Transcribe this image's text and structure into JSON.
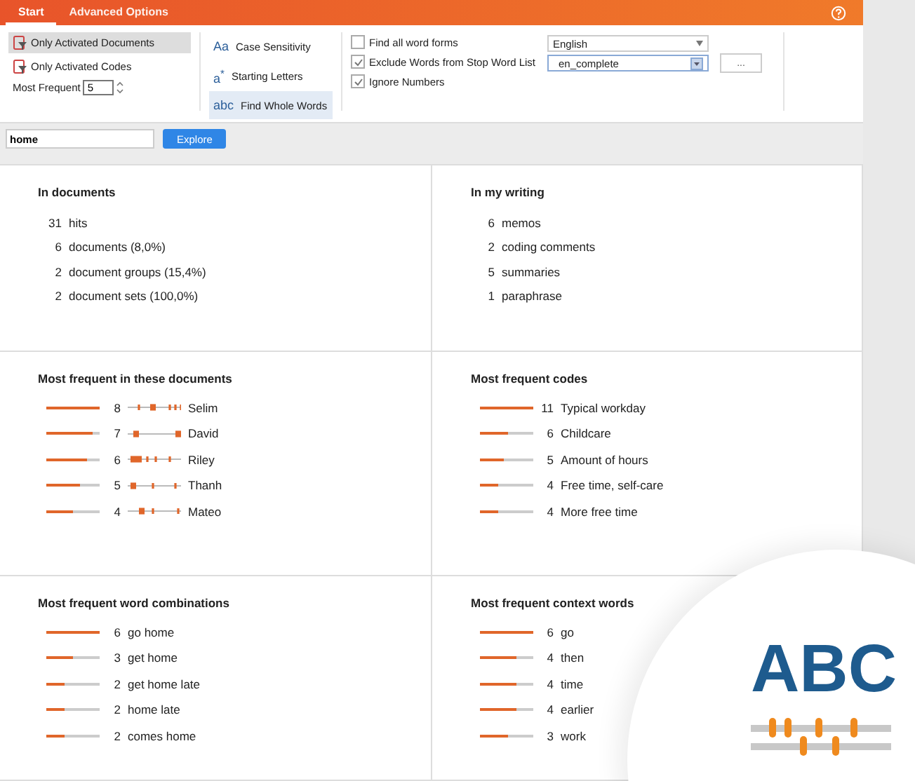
{
  "tabs": [
    {
      "label": "Start",
      "selected": true
    },
    {
      "label": "Advanced Options",
      "selected": false
    }
  ],
  "ribbon": {
    "filters": [
      {
        "label": "Only Activated Documents",
        "selected": true
      },
      {
        "label": "Only Activated Codes",
        "selected": false
      }
    ],
    "most_frequent": {
      "label": "Most Frequent",
      "value": "5"
    },
    "match_options": [
      {
        "icon": "Aa",
        "label": "Case Sensitivity",
        "selected": false
      },
      {
        "icon": "a$^{*}$",
        "label": "Starting Letters",
        "selected": false
      },
      {
        "icon": "abc",
        "label": "Find Whole Words",
        "selected": true
      }
    ],
    "checkboxes": [
      {
        "label": "Find all word forms",
        "checked": false
      },
      {
        "label": "Exclude Words from Stop Word List",
        "checked": true
      },
      {
        "label": "Ignore Numbers",
        "checked": true
      }
    ],
    "language": "English",
    "stop_word_list": "en_complete",
    "more_button": "..."
  },
  "search": {
    "value": "home",
    "button": "Explore"
  },
  "panels": [
    {
      "title": "In documents",
      "kind": "stats",
      "items": [
        {
          "count": "31",
          "label": "hits"
        },
        {
          "count": "6",
          "label": "documents (8,0%)"
        },
        {
          "count": "2",
          "label": "document groups (15,4%)"
        },
        {
          "count": "2",
          "label": "document sets (100,0%)"
        }
      ]
    },
    {
      "title": "In my writing",
      "kind": "stats",
      "items": [
        {
          "count": "6",
          "label": "memos"
        },
        {
          "count": "2",
          "label": "coding comments"
        },
        {
          "count": "5",
          "label": "summaries"
        },
        {
          "count": "1",
          "label": "paraphrase"
        }
      ]
    },
    {
      "title": "Most frequent in these documents",
      "kind": "distribution",
      "items": [
        {
          "count": "8",
          "label": "Selim",
          "level": 1
        },
        {
          "count": "7",
          "label": "David",
          "level": 0.87
        },
        {
          "count": "6",
          "label": "Riley",
          "level": 0.75
        },
        {
          "count": "5",
          "label": "Thanh",
          "level": 0.62
        },
        {
          "count": "4",
          "label": "Mateo",
          "level": 0.5
        }
      ]
    },
    {
      "title": "Most frequent codes",
      "kind": "bars",
      "items": [
        {
          "count": "11",
          "label": "Typical workday",
          "level": 1
        },
        {
          "count": "6",
          "label": "Childcare",
          "level": 0.55
        },
        {
          "count": "5",
          "label": "Amount of hours",
          "level": 0.45
        },
        {
          "count": "4",
          "label": "Free time, self-care",
          "level": 0.36
        },
        {
          "count": "4",
          "label": "More free time",
          "level": 0.36
        }
      ]
    },
    {
      "title": "Most frequent word combinations",
      "kind": "bars",
      "items": [
        {
          "count": "6",
          "label": "go home",
          "level": 1
        },
        {
          "count": "3",
          "label": "get home",
          "level": 0.5
        },
        {
          "count": "2",
          "label": "get home late",
          "level": 0.35
        },
        {
          "count": "2",
          "label": "home late",
          "level": 0.35
        },
        {
          "count": "2",
          "label": "comes home",
          "level": 0.35
        }
      ]
    },
    {
      "title": "Most frequent context words",
      "kind": "bars",
      "items": [
        {
          "count": "6",
          "label": "go",
          "level": 1
        },
        {
          "count": "4",
          "label": "then",
          "level": 0.7
        },
        {
          "count": "4",
          "label": "time",
          "level": 0.7
        },
        {
          "count": "4",
          "label": "earlier",
          "level": 0.7
        },
        {
          "count": "3",
          "label": "work",
          "level": 0.55
        }
      ]
    }
  ],
  "overlay": {
    "logo": "ABC"
  }
}
